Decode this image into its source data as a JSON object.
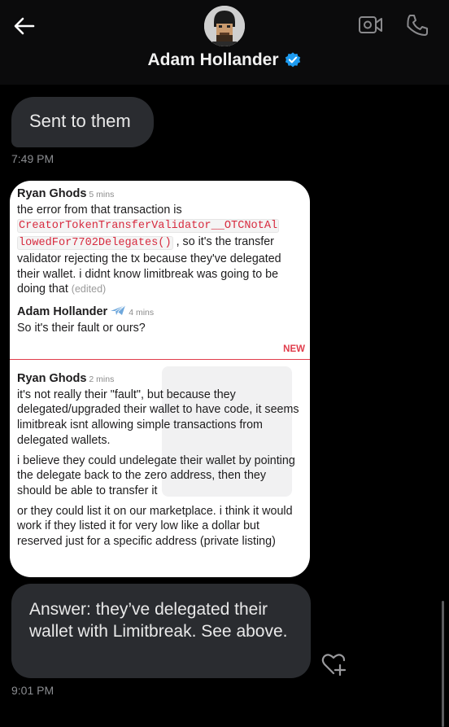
{
  "header": {
    "contact_name": "Adam Hollander",
    "verified": true,
    "accent_color": "#1d9bf0"
  },
  "icons": {
    "back": "arrow-left-icon",
    "video_call": "video-camera-icon",
    "voice_call": "phone-icon",
    "verified": "verified-badge-icon",
    "reaction": "heart-plus-icon"
  },
  "messages": [
    {
      "text": "Sent to them",
      "timestamp": "7:49 PM"
    },
    {
      "type": "image"
    },
    {
      "text": "Answer: they’ve delegated their wallet with Limitbreak. See above.",
      "timestamp": "9:01 PM"
    }
  ],
  "screenshot": {
    "m1": {
      "author": "Ryan Ghods",
      "time": "5 mins",
      "text_before": "the error from that transaction is",
      "code": "CreatorTokenTransferValidator__OTCNotAllowedFor7702Delegates()",
      "code_line1": "CreatorTokenTransferValidator__OTCNotAl",
      "code_line2": "lowedFor7702Delegates()",
      "text_after": ", so it's the transfer validator rejecting the tx because they've delegated their wallet. i didnt know limitbreak was going to be doing that",
      "edited": "(edited)"
    },
    "m2": {
      "author": "Adam Hollander",
      "time": "4 mins",
      "text": "So it's their fault or ours?"
    },
    "new_label": "NEW",
    "m3": {
      "author": "Ryan Ghods",
      "time": "2 mins",
      "p1": "it's not really their \"fault\", but because they delegated/upgraded their wallet to have code, it seems limitbreak isnt allowing simple transactions from delegated wallets.",
      "p2": "i believe they could undelegate their wallet by pointing the delegate back to the zero address, then they should be able to transfer it",
      "p3": "or they could list it on our marketplace. i think it would work if they listed it for very low like a dollar but reserved just for a specific address (private listing)"
    }
  }
}
